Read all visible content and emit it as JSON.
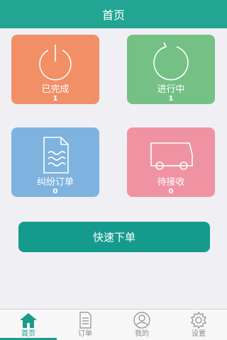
{
  "header": {
    "title": "首页"
  },
  "tiles": [
    {
      "label": "已完成",
      "count": "1",
      "color": "#f19067",
      "icon": "power-icon"
    },
    {
      "label": "进行中",
      "count": "1",
      "color": "#75c085",
      "icon": "refresh-icon"
    },
    {
      "label": "纠纷订单",
      "count": "0",
      "color": "#7eb3df",
      "icon": "document-icon"
    },
    {
      "label": "待接收",
      "count": "0",
      "color": "#ef93a3",
      "icon": "truck-icon"
    }
  ],
  "quick_order": {
    "label": "快速下单",
    "color": "#159b8e"
  },
  "tabbar": {
    "active_color": "#1b9c8b",
    "items": [
      {
        "label": "首页",
        "icon": "home-icon",
        "active": true
      },
      {
        "label": "订单",
        "icon": "order-icon",
        "active": false
      },
      {
        "label": "我的",
        "icon": "user-icon",
        "active": false
      },
      {
        "label": "设置",
        "icon": "gear-icon",
        "active": false
      }
    ]
  }
}
